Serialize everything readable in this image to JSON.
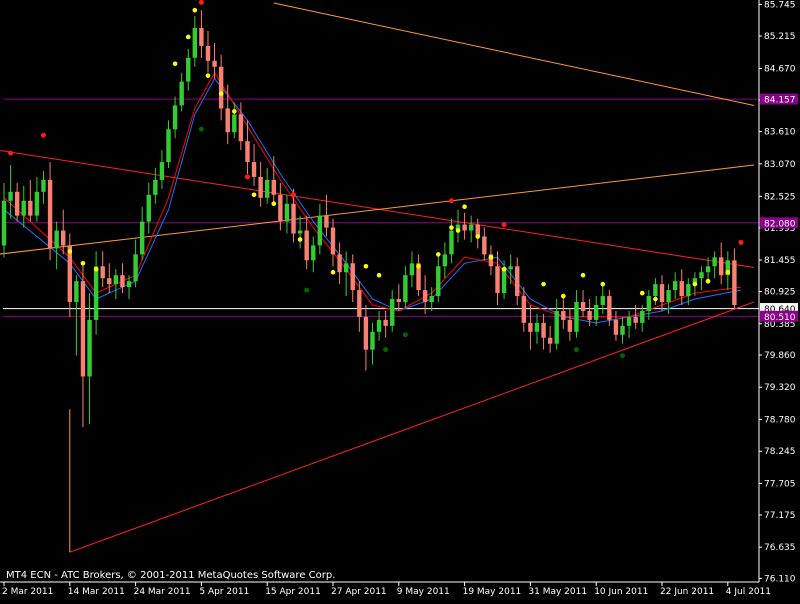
{
  "chart_data": {
    "type": "candlestick",
    "watermark": "MT4 ECN - ATC Brokers, © 2001-2011 MetaQuotes Software Corp.",
    "ylim": [
      76.1,
      85.77
    ],
    "y_ticks": [
      "85.745",
      "85.215",
      "84.670",
      "84.140",
      "83.610",
      "83.070",
      "82.525",
      "81.995",
      "81.455",
      "80.925",
      "80.385",
      "79.860",
      "79.320",
      "78.780",
      "78.245",
      "77.705",
      "77.175",
      "76.635",
      "76.110"
    ],
    "x_ticks": [
      {
        "label": "2 Mar 2011",
        "bar": 0
      },
      {
        "label": "14 Mar 2011",
        "bar": 10
      },
      {
        "label": "24 Mar 2011",
        "bar": 20
      },
      {
        "label": "5 Apr 2011",
        "bar": 30
      },
      {
        "label": "15 Apr 2011",
        "bar": 40
      },
      {
        "label": "27 Apr 2011",
        "bar": 50
      },
      {
        "label": "9 May 2011",
        "bar": 60
      },
      {
        "label": "19 May 2011",
        "bar": 70
      },
      {
        "label": "31 May 2011",
        "bar": 80
      },
      {
        "label": "10 Jun 2011",
        "bar": 90
      },
      {
        "label": "22 Jun 2011",
        "bar": 100
      },
      {
        "label": "4 Jul 2011",
        "bar": 110
      }
    ],
    "bars": [
      [
        81.7,
        82.75,
        81.5,
        82.45
      ],
      [
        82.45,
        83.05,
        82.15,
        82.6
      ],
      [
        82.6,
        82.75,
        82.1,
        82.2
      ],
      [
        82.2,
        82.7,
        82.0,
        82.45
      ],
      [
        82.45,
        82.8,
        82.1,
        82.2
      ],
      [
        82.2,
        82.85,
        82.1,
        82.6
      ],
      [
        82.6,
        82.95,
        82.4,
        82.8
      ],
      [
        82.8,
        83.1,
        81.45,
        81.65
      ],
      [
        81.65,
        82.1,
        81.3,
        81.95
      ],
      [
        81.95,
        82.3,
        81.55,
        81.7
      ],
      [
        81.7,
        81.9,
        80.5,
        80.75
      ],
      [
        80.75,
        81.2,
        79.85,
        81.1
      ],
      [
        81.1,
        81.4,
        78.65,
        79.5
      ],
      [
        79.5,
        80.9,
        78.7,
        80.45
      ],
      [
        80.45,
        81.6,
        80.2,
        81.35
      ],
      [
        81.35,
        81.6,
        81.0,
        81.15
      ],
      [
        81.15,
        81.4,
        80.9,
        81.05
      ],
      [
        81.05,
        81.3,
        80.8,
        81.2
      ],
      [
        81.2,
        81.4,
        80.9,
        81.0
      ],
      [
        81.0,
        81.2,
        80.8,
        81.1
      ],
      [
        81.1,
        81.8,
        81.0,
        81.55
      ],
      [
        81.55,
        82.35,
        81.45,
        82.1
      ],
      [
        82.1,
        82.75,
        81.9,
        82.55
      ],
      [
        82.55,
        83.0,
        82.4,
        82.8
      ],
      [
        82.8,
        83.3,
        82.65,
        83.1
      ],
      [
        83.1,
        83.8,
        83.0,
        83.65
      ],
      [
        83.65,
        84.2,
        83.5,
        84.05
      ],
      [
        84.05,
        84.6,
        83.95,
        84.45
      ],
      [
        84.45,
        85.0,
        84.3,
        84.85
      ],
      [
        84.85,
        85.55,
        84.7,
        85.35
      ],
      [
        85.35,
        85.65,
        84.85,
        85.05
      ],
      [
        85.05,
        85.3,
        84.6,
        84.8
      ],
      [
        84.8,
        85.1,
        84.5,
        84.7
      ],
      [
        84.7,
        84.9,
        83.8,
        84.0
      ],
      [
        84.0,
        84.4,
        83.4,
        83.6
      ],
      [
        83.6,
        84.1,
        83.5,
        83.9
      ],
      [
        83.9,
        84.1,
        83.3,
        83.45
      ],
      [
        83.45,
        83.8,
        82.9,
        83.1
      ],
      [
        83.1,
        83.4,
        82.7,
        82.85
      ],
      [
        82.85,
        83.1,
        82.35,
        82.5
      ],
      [
        82.5,
        83.0,
        82.4,
        82.8
      ],
      [
        82.8,
        83.2,
        82.4,
        82.55
      ],
      [
        82.55,
        82.75,
        81.95,
        82.1
      ],
      [
        82.1,
        82.55,
        81.9,
        82.4
      ],
      [
        82.4,
        82.65,
        81.75,
        81.9
      ],
      [
        81.9,
        82.2,
        81.65,
        81.95
      ],
      [
        81.95,
        82.2,
        81.3,
        81.45
      ],
      [
        81.45,
        81.85,
        81.25,
        81.7
      ],
      [
        81.7,
        82.4,
        81.55,
        82.2
      ],
      [
        82.2,
        82.55,
        81.85,
        82.0
      ],
      [
        82.0,
        82.15,
        81.35,
        81.55
      ],
      [
        81.55,
        81.75,
        81.05,
        81.25
      ],
      [
        81.25,
        81.6,
        80.85,
        81.4
      ],
      [
        81.4,
        81.55,
        80.75,
        80.95
      ],
      [
        80.95,
        81.1,
        80.25,
        80.5
      ],
      [
        80.5,
        80.7,
        79.6,
        79.95
      ],
      [
        79.95,
        80.4,
        79.7,
        80.25
      ],
      [
        80.25,
        80.6,
        80.1,
        80.45
      ],
      [
        80.45,
        80.6,
        80.15,
        80.35
      ],
      [
        80.35,
        80.95,
        80.25,
        80.8
      ],
      [
        80.8,
        81.05,
        80.6,
        80.75
      ],
      [
        80.75,
        81.35,
        80.65,
        81.2
      ],
      [
        81.2,
        81.6,
        81.0,
        81.4
      ],
      [
        81.4,
        81.55,
        80.85,
        80.95
      ],
      [
        80.95,
        81.2,
        80.55,
        80.75
      ],
      [
        80.75,
        81.0,
        80.6,
        80.85
      ],
      [
        80.85,
        81.55,
        80.75,
        81.35
      ],
      [
        81.35,
        81.75,
        81.15,
        81.55
      ],
      [
        81.55,
        82.15,
        81.4,
        81.95
      ],
      [
        81.95,
        82.3,
        81.75,
        82.05
      ],
      [
        82.05,
        82.25,
        81.8,
        81.95
      ],
      [
        81.95,
        82.2,
        81.75,
        82.05
      ],
      [
        82.05,
        82.15,
        81.65,
        81.85
      ],
      [
        81.85,
        82.0,
        81.45,
        81.55
      ],
      [
        81.55,
        81.7,
        81.2,
        81.35
      ],
      [
        81.35,
        81.6,
        80.7,
        80.9
      ],
      [
        80.9,
        81.45,
        80.8,
        81.3
      ],
      [
        81.3,
        81.55,
        81.05,
        81.35
      ],
      [
        81.35,
        81.5,
        80.7,
        80.85
      ],
      [
        80.85,
        81.0,
        80.25,
        80.4
      ],
      [
        80.4,
        80.7,
        79.95,
        80.25
      ],
      [
        80.25,
        80.55,
        80.05,
        80.4
      ],
      [
        80.4,
        80.55,
        79.95,
        80.15
      ],
      [
        80.15,
        80.35,
        79.9,
        80.05
      ],
      [
        80.05,
        80.8,
        79.95,
        80.6
      ],
      [
        80.6,
        80.85,
        80.3,
        80.45
      ],
      [
        80.45,
        80.65,
        80.1,
        80.25
      ],
      [
        80.25,
        80.95,
        80.15,
        80.75
      ],
      [
        80.75,
        80.95,
        80.5,
        80.6
      ],
      [
        80.6,
        80.8,
        80.35,
        80.45
      ],
      [
        80.45,
        80.85,
        80.35,
        80.7
      ],
      [
        80.7,
        81.05,
        80.55,
        80.85
      ],
      [
        80.85,
        80.95,
        80.35,
        80.45
      ],
      [
        80.45,
        80.6,
        80.1,
        80.2
      ],
      [
        80.2,
        80.5,
        80.05,
        80.35
      ],
      [
        80.35,
        80.6,
        80.15,
        80.5
      ],
      [
        80.5,
        80.7,
        80.3,
        80.4
      ],
      [
        80.4,
        80.7,
        80.25,
        80.6
      ],
      [
        80.6,
        80.95,
        80.45,
        80.85
      ],
      [
        80.85,
        81.15,
        80.7,
        81.05
      ],
      [
        81.05,
        81.2,
        80.6,
        80.75
      ],
      [
        80.75,
        81.05,
        80.55,
        80.95
      ],
      [
        80.95,
        81.25,
        80.8,
        81.1
      ],
      [
        81.1,
        81.3,
        80.7,
        80.85
      ],
      [
        80.85,
        81.15,
        80.7,
        81.05
      ],
      [
        81.05,
        81.25,
        80.85,
        81.15
      ],
      [
        81.15,
        81.35,
        80.95,
        81.25
      ],
      [
        81.25,
        81.5,
        81.05,
        81.35
      ],
      [
        81.35,
        81.6,
        81.15,
        81.5
      ],
      [
        81.5,
        81.75,
        81.05,
        81.2
      ],
      [
        81.2,
        81.6,
        80.95,
        81.45
      ],
      [
        81.45,
        81.65,
        80.65,
        80.7
      ]
    ],
    "ma_red": [
      [
        0,
        82.5
      ],
      [
        10,
        81.5
      ],
      [
        14,
        80.9
      ],
      [
        20,
        81.2
      ],
      [
        25,
        82.5
      ],
      [
        29,
        84.0
      ],
      [
        32,
        84.6
      ],
      [
        37,
        83.7
      ],
      [
        42,
        82.8
      ],
      [
        47,
        82.0
      ],
      [
        52,
        81.3
      ],
      [
        56,
        80.7
      ],
      [
        60,
        80.6
      ],
      [
        65,
        80.9
      ],
      [
        70,
        81.5
      ],
      [
        75,
        81.4
      ],
      [
        80,
        80.7
      ],
      [
        85,
        80.5
      ],
      [
        90,
        80.5
      ],
      [
        95,
        80.5
      ],
      [
        100,
        80.7
      ],
      [
        105,
        80.9
      ],
      [
        112,
        81.0
      ]
    ],
    "ma_blue": [
      [
        0,
        82.3
      ],
      [
        10,
        81.4
      ],
      [
        14,
        80.8
      ],
      [
        20,
        81.1
      ],
      [
        25,
        82.3
      ],
      [
        29,
        83.9
      ],
      [
        32,
        84.5
      ],
      [
        37,
        83.8
      ],
      [
        42,
        82.9
      ],
      [
        47,
        82.1
      ],
      [
        52,
        81.4
      ],
      [
        56,
        80.8
      ],
      [
        60,
        80.6
      ],
      [
        65,
        80.8
      ],
      [
        70,
        81.4
      ],
      [
        75,
        81.5
      ],
      [
        80,
        80.8
      ],
      [
        85,
        80.5
      ],
      [
        90,
        80.4
      ],
      [
        95,
        80.5
      ],
      [
        100,
        80.6
      ],
      [
        105,
        80.8
      ],
      [
        112,
        80.95
      ]
    ],
    "fractal_up_red": [
      [
        1,
        83.25
      ],
      [
        6,
        83.55
      ],
      [
        30,
        85.78
      ],
      [
        37,
        82.85
      ],
      [
        44,
        82.55
      ],
      [
        68,
        82.45
      ],
      [
        76,
        82.05
      ],
      [
        112,
        81.75
      ]
    ],
    "fractal_down_green": [
      [
        30,
        83.65
      ],
      [
        46,
        80.95
      ],
      [
        58,
        79.95
      ],
      [
        61,
        80.2
      ],
      [
        87,
        79.95
      ],
      [
        94,
        79.85
      ]
    ],
    "sar_yellow": [
      [
        10,
        81.6
      ],
      [
        12,
        81.4
      ],
      [
        14,
        81.3
      ],
      [
        26,
        84.75
      ],
      [
        28,
        85.2
      ],
      [
        29,
        85.65
      ],
      [
        31,
        84.55
      ],
      [
        33,
        84.25
      ],
      [
        35,
        83.95
      ],
      [
        38,
        82.55
      ],
      [
        41,
        82.4
      ],
      [
        45,
        81.8
      ],
      [
        50,
        81.25
      ],
      [
        55,
        81.35
      ],
      [
        57,
        81.2
      ],
      [
        63,
        81.35
      ],
      [
        66,
        81.55
      ],
      [
        68,
        82.0
      ],
      [
        69,
        81.95
      ],
      [
        70,
        82.35
      ],
      [
        72,
        81.85
      ],
      [
        74,
        81.5
      ],
      [
        76,
        81.3
      ],
      [
        82,
        81.05
      ],
      [
        85,
        80.85
      ],
      [
        88,
        81.2
      ],
      [
        91,
        81.05
      ],
      [
        97,
        80.9
      ],
      [
        99,
        80.8
      ],
      [
        105,
        81.05
      ],
      [
        107,
        81.1
      ],
      [
        110,
        81.25
      ]
    ],
    "h_lines": [
      {
        "value": 84.157,
        "label": "84.157",
        "color": "#8b008b"
      },
      {
        "value": 82.08,
        "label": "82.080",
        "color": "#8b008b"
      },
      {
        "value": 80.64,
        "label": "80.640",
        "color": "#ffffff"
      },
      {
        "value": 80.51,
        "label": "80.510",
        "color": "#8b008b"
      }
    ],
    "trend_lines": [
      {
        "color": "#ff2020",
        "p1": [
          -1,
          83.3
        ],
        "p2": [
          114,
          81.33
        ]
      },
      {
        "color": "#ff2020",
        "p1": [
          10,
          76.55
        ],
        "p2": [
          114,
          80.75
        ]
      },
      {
        "color": "#ff9a33",
        "p1": [
          -1,
          81.55
        ],
        "p2": [
          114,
          83.05
        ]
      },
      {
        "color": "#ff9a33",
        "p1": [
          41,
          85.77
        ],
        "p2": [
          114,
          84.05
        ]
      }
    ],
    "drop_line": {
      "color": "#ff9a33",
      "bar": 10,
      "from": 78.95,
      "to": 76.55
    },
    "colors": {
      "bull": "#32cd32",
      "bear": "#fa8072",
      "background": "#000000",
      "ma_red": "#ff0000",
      "ma_blue": "#1e6fff",
      "fractal_up": "#ff1a1a",
      "fractal_down": "#006400",
      "sar": "#ffff00"
    }
  }
}
